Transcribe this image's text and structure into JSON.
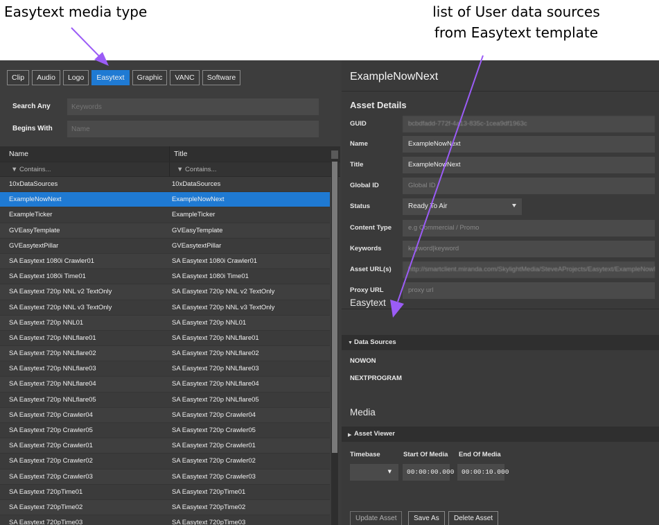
{
  "annotations": {
    "media_type_label": "Easytext media type",
    "data_sources_label_line1": "list of User data sources",
    "data_sources_label_line2": "from Easytext template"
  },
  "colors": {
    "accent": "#1f7ad3",
    "arrow": "#9b5cf6"
  },
  "media_types": [
    "Clip",
    "Audio",
    "Logo",
    "Easytext",
    "Graphic",
    "VANC",
    "Software"
  ],
  "active_media_type": "Easytext",
  "search": {
    "search_any_label": "Search Any",
    "search_any_placeholder": "Keywords",
    "begins_with_label": "Begins With",
    "begins_with_placeholder": "Name"
  },
  "table": {
    "headers": [
      "Name",
      "Title"
    ],
    "filter": "Contains...",
    "rows": [
      {
        "name": "10xDataSources",
        "title": "10xDataSources"
      },
      {
        "name": "ExampleNowNext",
        "title": "ExampleNowNext",
        "selected": true
      },
      {
        "name": "ExampleTicker",
        "title": "ExampleTicker"
      },
      {
        "name": "GVEasyTemplate",
        "title": "GVEasyTemplate"
      },
      {
        "name": "GVEasytextPillar",
        "title": "GVEasytextPillar"
      },
      {
        "name": "SA Easytext 1080i Crawler01",
        "title": "SA Easytext 1080i Crawler01"
      },
      {
        "name": "SA Easytext 1080i Time01",
        "title": "SA Easytext 1080i Time01"
      },
      {
        "name": "SA Easytext 720p NNL v2 TextOnly",
        "title": "SA Easytext 720p NNL v2 TextOnly"
      },
      {
        "name": "SA Easytext 720p NNL v3 TextOnly",
        "title": "SA Easytext 720p NNL v3 TextOnly"
      },
      {
        "name": "SA Easytext 720p NNL01",
        "title": "SA Easytext 720p NNL01"
      },
      {
        "name": "SA Easytext 720p NNLflare01",
        "title": "SA Easytext 720p NNLflare01"
      },
      {
        "name": "SA Easytext 720p NNLflare02",
        "title": "SA Easytext 720p NNLflare02"
      },
      {
        "name": "SA Easytext 720p NNLflare03",
        "title": "SA Easytext 720p NNLflare03"
      },
      {
        "name": "SA Easytext 720p NNLflare04",
        "title": "SA Easytext 720p NNLflare04"
      },
      {
        "name": "SA Easytext 720p NNLflare05",
        "title": "SA Easytext 720p NNLflare05"
      },
      {
        "name": "SA Easytext 720p Crawler04",
        "title": "SA Easytext 720p Crawler04"
      },
      {
        "name": "SA Easytext 720p Crawler05",
        "title": "SA Easytext 720p Crawler05"
      },
      {
        "name": "SA Easytext 720p Crawler01",
        "title": "SA Easytext 720p Crawler01"
      },
      {
        "name": "SA Easytext 720p Crawler02",
        "title": "SA Easytext 720p Crawler02"
      },
      {
        "name": "SA Easytext 720p Crawler03",
        "title": "SA Easytext 720p Crawler03"
      },
      {
        "name": "SA Easytext 720pTime01",
        "title": "SA Easytext 720pTime01"
      },
      {
        "name": "SA Easytext 720pTime02",
        "title": "SA Easytext 720pTime02"
      },
      {
        "name": "SA Easytext 720pTime03",
        "title": "SA Easytext 720pTime03"
      }
    ]
  },
  "details": {
    "title": "ExampleNowNext",
    "asset_details_heading": "Asset Details",
    "guid_label": "GUID",
    "guid_value": "bcbdfadd-772f-4a13-835c-1cea9df1963c",
    "name_label": "Name",
    "name_value": "ExampleNowNext",
    "title_label": "Title",
    "title_value": "ExampleNowNext",
    "global_id_label": "Global ID",
    "global_id_placeholder": "Global ID",
    "status_label": "Status",
    "status_value": "Ready To Air",
    "content_type_label": "Content Type",
    "content_type_placeholder": "e.g Commercial / Promo",
    "keywords_label": "Keywords",
    "keywords_placeholder": "keyword|keyword",
    "asset_urls_label": "Asset URL(s)",
    "asset_urls_value": "http://smartclient.miranda.com/SkylightMedia/SteveAProjects/Easytext/ExampleNowNext",
    "proxy_url_label": "Proxy URL",
    "proxy_url_placeholder": "proxy url"
  },
  "easytext": {
    "heading": "Easytext",
    "data_sources_label": "Data Sources",
    "data_sources": [
      "NOWON",
      "NEXTPROGRAM"
    ]
  },
  "media": {
    "heading": "Media",
    "asset_viewer_label": "Asset Viewer",
    "timebase_label": "Timebase",
    "start_label": "Start Of Media",
    "end_label": "End Of Media",
    "start_value": "00:00:00.000",
    "end_value": "00:00:10.000"
  },
  "actions": {
    "update": "Update Asset",
    "save_as": "Save As",
    "delete": "Delete Asset"
  }
}
